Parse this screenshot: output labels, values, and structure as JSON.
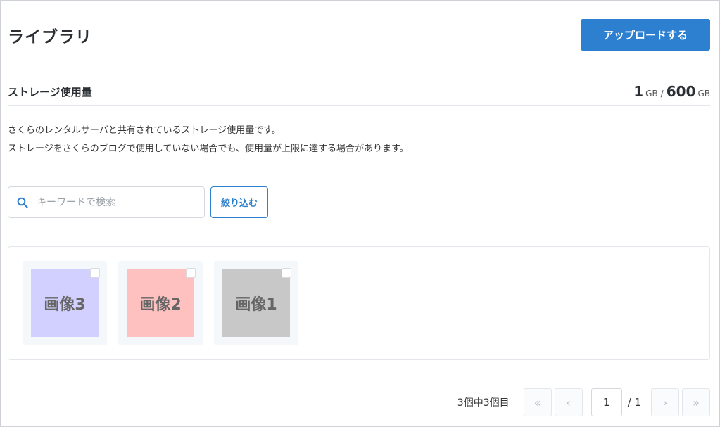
{
  "header": {
    "title": "ライブラリ",
    "upload_label": "アップロードする"
  },
  "storage": {
    "label": "ストレージ使用量",
    "used": "1",
    "used_unit": "GB",
    "separator": "/",
    "total": "600",
    "total_unit": "GB"
  },
  "description": {
    "line1": "さくらのレンタルサーバと共有されているストレージ使用量です。",
    "line2": "ストレージをさくらのブログで使用していない場合でも、使用量が上限に達する場合があります。"
  },
  "search": {
    "placeholder": "キーワードで検索",
    "value": "",
    "icon": "search-icon"
  },
  "filter": {
    "label": "絞り込む"
  },
  "images": [
    {
      "label": "画像3",
      "color": "#d2d0fe"
    },
    {
      "label": "画像2",
      "color": "#ffc0c0"
    },
    {
      "label": "画像1",
      "color": "#c8c8c8"
    }
  ],
  "pagination": {
    "count_text": "3個中3個目",
    "first": "«",
    "prev": "‹",
    "current": "1",
    "total_text": "/ 1",
    "next": "›",
    "last": "»"
  },
  "colors": {
    "accent": "#2d7fd0"
  }
}
